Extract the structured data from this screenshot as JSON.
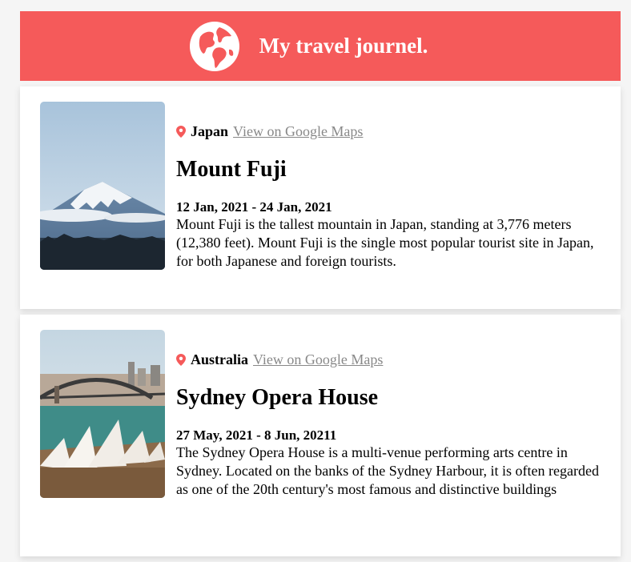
{
  "header": {
    "title": "My travel journel."
  },
  "entries": [
    {
      "country": "Japan",
      "maps_link": "View on Google Maps",
      "title": "Mount Fuji",
      "dates": "12 Jan, 2021 - 24 Jan, 2021",
      "description": "Mount Fuji is the tallest mountain in Japan, standing at 3,776 meters (12,380 feet). Mount Fuji is the single most popular tourist site in Japan, for both Japanese and foreign tourists."
    },
    {
      "country": "Australia",
      "maps_link": "View on Google Maps",
      "title": "Sydney Opera House",
      "dates": "27 May, 2021 - 8 Jun, 20211",
      "description": "The Sydney Opera House is a multi-venue performing arts centre in Sydney. Located on the banks of the Sydney Harbour, it is often regarded as one of the 20th century's most famous and distinctive buildings"
    }
  ],
  "colors": {
    "accent": "#f55a5a",
    "link": "#888888"
  },
  "icons": {
    "header": "globe-icon",
    "location": "location-pin-icon"
  }
}
